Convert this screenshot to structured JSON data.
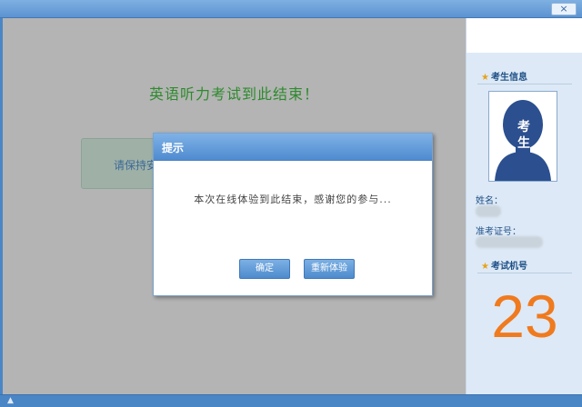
{
  "window": {
    "close_glyph": "×"
  },
  "main": {
    "end_message": "英语听力考试到此结束！",
    "behind_box_text": "请保持安"
  },
  "sidebar": {
    "section_candidate": "考生信息",
    "photo_text": "考\n生",
    "name_label": "姓名：",
    "ticket_label": "准考证号：",
    "section_seat": "考试机号",
    "seat_number": "23"
  },
  "dialog": {
    "title": "提示",
    "message": "本次在线体验到此结束，感谢您的参与...",
    "confirm_label": "确定",
    "retry_label": "重新体验"
  },
  "colors": {
    "accent_blue": "#4f8bd0",
    "seat_number": "#f07a1e",
    "end_message": "#2e8a2e",
    "backdrop_gray": "#b4b4b4"
  },
  "icons": {
    "section_bullet": "star-icon",
    "close": "close-icon",
    "bottom": "status-icon"
  }
}
